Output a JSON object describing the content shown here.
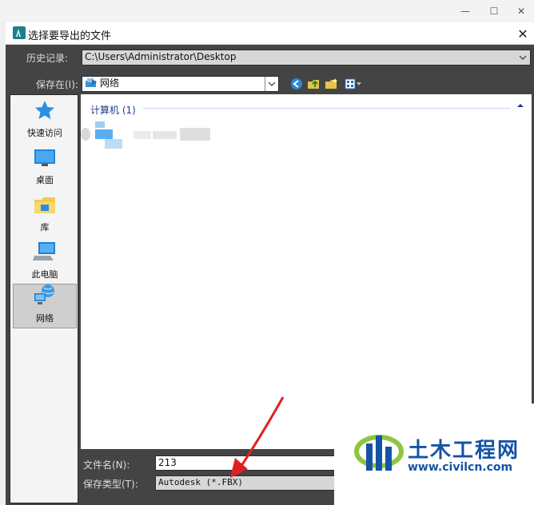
{
  "window": {
    "minimize": "—",
    "maximize": "☐",
    "close": "✕"
  },
  "dialog": {
    "title": "选择要导出的文件",
    "close": "✕"
  },
  "history": {
    "label": "历史记录:",
    "value": "C:\\Users\\Administrator\\Desktop"
  },
  "save_in": {
    "label": "保存在(I):",
    "value": "网络"
  },
  "toolbar": {
    "back": "back-icon",
    "up": "up-folder-icon",
    "new_folder": "new-folder-icon",
    "view_menu": "view-menu-icon"
  },
  "sidebar": {
    "items": [
      {
        "label": "快速访问",
        "icon": "star-icon"
      },
      {
        "label": "桌面",
        "icon": "desktop-icon"
      },
      {
        "label": "库",
        "icon": "library-icon"
      },
      {
        "label": "此电脑",
        "icon": "computer-icon"
      },
      {
        "label": "网络",
        "icon": "network-icon",
        "selected": true
      }
    ]
  },
  "file_list": {
    "group_label": "计算机 (1)"
  },
  "filename": {
    "label": "文件名(N):",
    "value": "213"
  },
  "filetype": {
    "label": "保存类型(T):",
    "value": "Autodesk (*.FBX)"
  },
  "watermark": {
    "title": "土木工程网",
    "url": "www.civilcn.com"
  },
  "colors": {
    "dialog_bg": "#444444",
    "link_blue": "#1e3f8a",
    "arrow_red": "#e02020",
    "watermark_blue": "#1553a6"
  }
}
